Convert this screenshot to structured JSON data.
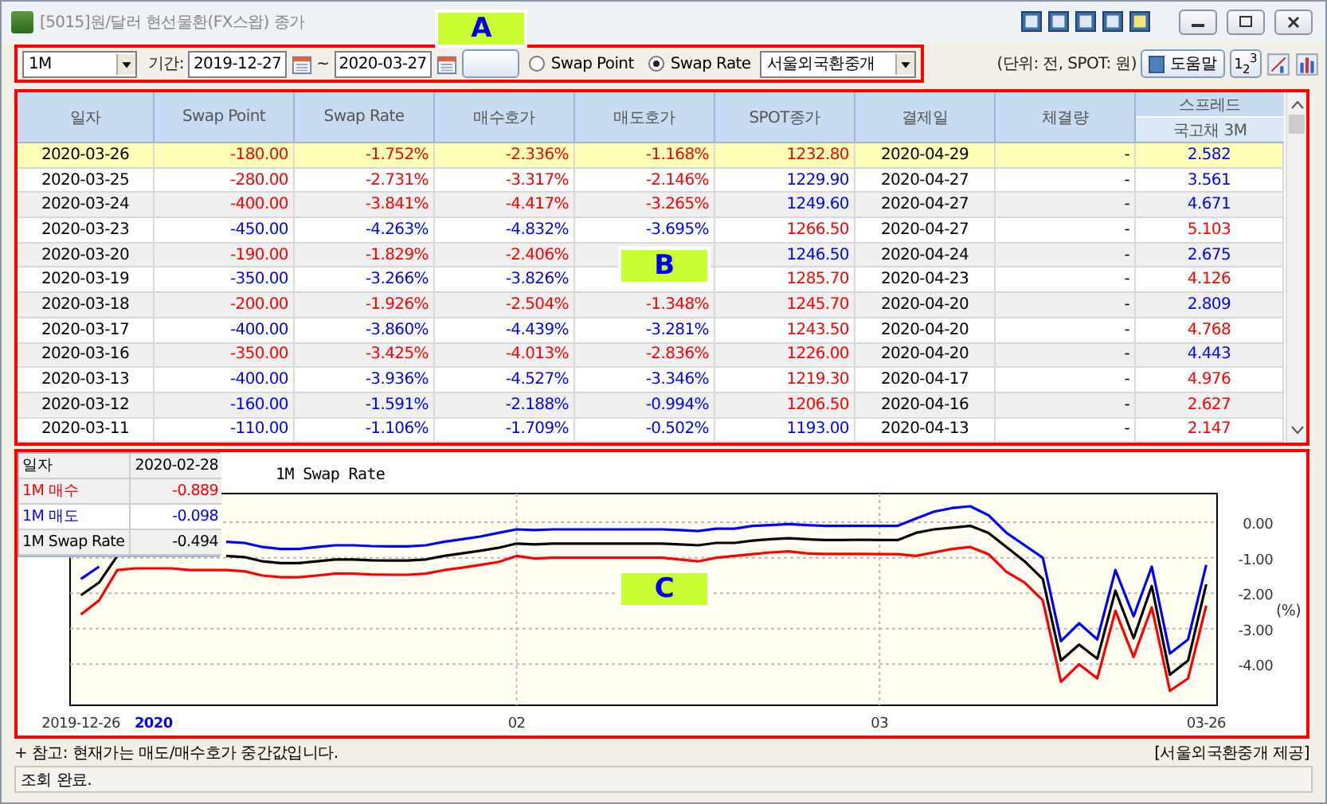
{
  "window": {
    "title": "[5015]원/달러 현선물환(FX스왑) 종가"
  },
  "toolbar": {
    "period_select": "1M",
    "period_label": "기간:",
    "start_date": "2019-12-27",
    "tilde": "~",
    "end_date": "2020-03-27",
    "radios": [
      {
        "label": "Swap Point",
        "selected": false
      },
      {
        "label": "Swap Rate",
        "selected": true
      }
    ],
    "broker_select": "서울외국환중개",
    "unit_note": "(단위: 전, SPOT: 원)",
    "help_button": "도움말",
    "number_format_button": "1$_{2}$$^{3}$"
  },
  "table": {
    "columns": [
      {
        "label": "일자"
      },
      {
        "label": "Swap Point"
      },
      {
        "label": "Swap Rate"
      },
      {
        "label": "매수호가"
      },
      {
        "label": "매도호가"
      },
      {
        "label": "SPOT종가"
      },
      {
        "label": "결제일"
      },
      {
        "label": "체결량"
      },
      {
        "label": "스프레드",
        "sublabel": "국고채 3M"
      }
    ],
    "rows": [
      {
        "selected": true,
        "cells": [
          "2020-03-26",
          {
            "text": "-180.00",
            "color": "#ff0000"
          },
          {
            "text": "-1.752%",
            "color": "#ff0000"
          },
          {
            "text": "-2.336%",
            "color": "#ff0000"
          },
          {
            "text": "-1.168%",
            "color": "#ff0000"
          },
          {
            "text": "1232.80",
            "color": "#ff0000"
          },
          "2020-04-29",
          "-",
          {
            "text": "2.582",
            "color": "#0000ff"
          }
        ]
      },
      {
        "selected": false,
        "cells": [
          "2020-03-25",
          {
            "text": "-280.00",
            "color": "#ff0000"
          },
          {
            "text": "-2.731%",
            "color": "#ff0000"
          },
          {
            "text": "-3.317%",
            "color": "#ff0000"
          },
          {
            "text": "-2.146%",
            "color": "#ff0000"
          },
          {
            "text": "1229.90",
            "color": "#0000ff"
          },
          "2020-04-27",
          "-",
          {
            "text": "3.561",
            "color": "#0000ff"
          }
        ]
      },
      {
        "selected": false,
        "cells": [
          "2020-03-24",
          {
            "text": "-400.00",
            "color": "#ff0000"
          },
          {
            "text": "-3.841%",
            "color": "#ff0000"
          },
          {
            "text": "-4.417%",
            "color": "#ff0000"
          },
          {
            "text": "-3.265%",
            "color": "#ff0000"
          },
          {
            "text": "1249.60",
            "color": "#0000ff"
          },
          "2020-04-27",
          "-",
          {
            "text": "4.671",
            "color": "#0000ff"
          }
        ]
      },
      {
        "selected": false,
        "cells": [
          "2020-03-23",
          {
            "text": "-450.00",
            "color": "#0000ff"
          },
          {
            "text": "-4.263%",
            "color": "#0000ff"
          },
          {
            "text": "-4.832%",
            "color": "#0000ff"
          },
          {
            "text": "-3.695%",
            "color": "#0000ff"
          },
          {
            "text": "1266.50",
            "color": "#ff0000"
          },
          "2020-04-27",
          "-",
          {
            "text": "5.103",
            "color": "#ff0000"
          }
        ]
      },
      {
        "selected": false,
        "cells": [
          "2020-03-20",
          {
            "text": "-190.00",
            "color": "#ff0000"
          },
          {
            "text": "-1.829%",
            "color": "#ff0000"
          },
          {
            "text": "-2.406%",
            "color": "#ff0000"
          },
          null,
          {
            "text": "1246.50",
            "color": "#0000ff"
          },
          "2020-04-24",
          "-",
          {
            "text": "2.675",
            "color": "#0000ff"
          }
        ]
      },
      {
        "selected": false,
        "cells": [
          "2020-03-19",
          {
            "text": "-350.00",
            "color": "#0000ff"
          },
          {
            "text": "-3.266%",
            "color": "#0000ff"
          },
          {
            "text": "-3.826%",
            "color": "#0000ff"
          },
          null,
          {
            "text": "1285.70",
            "color": "#ff0000"
          },
          "2020-04-23",
          "-",
          {
            "text": "4.126",
            "color": "#ff0000"
          }
        ]
      },
      {
        "selected": false,
        "cells": [
          "2020-03-18",
          {
            "text": "-200.00",
            "color": "#ff0000"
          },
          {
            "text": "-1.926%",
            "color": "#ff0000"
          },
          {
            "text": "-2.504%",
            "color": "#ff0000"
          },
          {
            "text": "-1.348%",
            "color": "#ff0000"
          },
          {
            "text": "1245.70",
            "color": "#ff0000"
          },
          "2020-04-20",
          "-",
          {
            "text": "2.809",
            "color": "#0000ff"
          }
        ]
      },
      {
        "selected": false,
        "cells": [
          "2020-03-17",
          {
            "text": "-400.00",
            "color": "#0000ff"
          },
          {
            "text": "-3.860%",
            "color": "#0000ff"
          },
          {
            "text": "-4.439%",
            "color": "#0000ff"
          },
          {
            "text": "-3.281%",
            "color": "#0000ff"
          },
          {
            "text": "1243.50",
            "color": "#ff0000"
          },
          "2020-04-20",
          "-",
          {
            "text": "4.768",
            "color": "#ff0000"
          }
        ]
      },
      {
        "selected": false,
        "cells": [
          "2020-03-16",
          {
            "text": "-350.00",
            "color": "#ff0000"
          },
          {
            "text": "-3.425%",
            "color": "#ff0000"
          },
          {
            "text": "-4.013%",
            "color": "#ff0000"
          },
          {
            "text": "-2.836%",
            "color": "#ff0000"
          },
          {
            "text": "1226.00",
            "color": "#ff0000"
          },
          "2020-04-20",
          "-",
          {
            "text": "4.443",
            "color": "#0000ff"
          }
        ]
      },
      {
        "selected": false,
        "cells": [
          "2020-03-13",
          {
            "text": "-400.00",
            "color": "#0000ff"
          },
          {
            "text": "-3.936%",
            "color": "#0000ff"
          },
          {
            "text": "-4.527%",
            "color": "#0000ff"
          },
          {
            "text": "-3.346%",
            "color": "#0000ff"
          },
          {
            "text": "1219.30",
            "color": "#ff0000"
          },
          "2020-04-17",
          "-",
          {
            "text": "4.976",
            "color": "#ff0000"
          }
        ]
      },
      {
        "selected": false,
        "cells": [
          "2020-03-12",
          {
            "text": "-160.00",
            "color": "#0000ff"
          },
          {
            "text": "-1.591%",
            "color": "#0000ff"
          },
          {
            "text": "-2.188%",
            "color": "#0000ff"
          },
          {
            "text": "-0.994%",
            "color": "#0000ff"
          },
          {
            "text": "1206.50",
            "color": "#ff0000"
          },
          "2020-04-16",
          "-",
          {
            "text": "2.627",
            "color": "#ff0000"
          }
        ]
      },
      {
        "selected": false,
        "cells": [
          "2020-03-11",
          {
            "text": "-110.00",
            "color": "#0000ff"
          },
          {
            "text": "-1.106%",
            "color": "#0000ff"
          },
          {
            "text": "-1.709%",
            "color": "#0000ff"
          },
          {
            "text": "-0.502%",
            "color": "#0000ff"
          },
          {
            "text": "1193.00",
            "color": "#0000ff"
          },
          "2020-04-13",
          "-",
          {
            "text": "2.147",
            "color": "#ff0000"
          }
        ]
      }
    ]
  },
  "chart": {
    "tooltip": {
      "date_label": "일자",
      "date": "2020-02-28",
      "values": [
        "-0.889",
        "-0.098",
        "-0.494"
      ]
    },
    "chart_data": {
      "type": "line",
      "title": "1M Swap Rate",
      "ylabel": "(%)",
      "grid": true,
      "categories": [
        "2019-12-26",
        null,
        null,
        null,
        "2020",
        null,
        null,
        null,
        null,
        null,
        null,
        null,
        null,
        null,
        null,
        null,
        null,
        null,
        null,
        null,
        null,
        null,
        null,
        null,
        "02",
        null,
        null,
        null,
        null,
        null,
        null,
        null,
        null,
        null,
        null,
        null,
        null,
        null,
        null,
        null,
        null,
        null,
        null,
        null,
        "03",
        null,
        null,
        null,
        null,
        null,
        null,
        null,
        null,
        null,
        null,
        null,
        null,
        null,
        null,
        null,
        null,
        null,
        "03-26"
      ],
      "ylim": [
        -5.16,
        0.81
      ],
      "yticks": [
        {
          "value": 0,
          "label": "0.00"
        },
        {
          "value": -1,
          "label": "-1.00"
        },
        {
          "value": -2,
          "label": "-2.00"
        },
        {
          "value": -3,
          "label": "-3.00"
        },
        {
          "value": -4,
          "label": "-4.00"
        }
      ],
      "series": [
        {
          "name": "1M 매수",
          "color": "#ff0000",
          "values": [
            -2.6,
            -2.2,
            -1.35,
            -1.3,
            -1.3,
            -1.3,
            -1.35,
            -1.35,
            -1.35,
            -1.38,
            -1.5,
            -1.55,
            -1.55,
            -1.5,
            -1.45,
            -1.45,
            -1.47,
            -1.48,
            -1.48,
            -1.45,
            -1.35,
            -1.28,
            -1.2,
            -1.12,
            -0.95,
            -1.02,
            -1.0,
            -1.0,
            -1.0,
            -1.0,
            -1.0,
            -1.0,
            -1.0,
            -1.05,
            -1.1,
            -1.0,
            -0.95,
            -0.9,
            -0.85,
            -0.82,
            -0.88,
            -0.89,
            -0.89,
            -0.89,
            -0.9,
            -0.9,
            -0.95,
            -0.85,
            -0.75,
            -0.7,
            -0.9,
            -1.4,
            -1.7,
            -2.2,
            -4.5,
            -4.0,
            -4.4,
            -2.5,
            -3.8,
            -2.4,
            -4.75,
            -4.4,
            -2.35
          ]
        },
        {
          "name": "1M 매도",
          "color": "#0000ff",
          "values": [
            -1.6,
            -1.25,
            null,
            null,
            null,
            null,
            null,
            null,
            -0.55,
            -0.58,
            -0.7,
            -0.75,
            -0.75,
            -0.7,
            -0.65,
            -0.65,
            -0.67,
            -0.68,
            -0.68,
            -0.65,
            -0.55,
            -0.48,
            -0.4,
            -0.3,
            -0.2,
            -0.22,
            -0.2,
            -0.2,
            -0.2,
            -0.2,
            -0.2,
            -0.2,
            -0.2,
            -0.22,
            -0.25,
            -0.18,
            -0.18,
            -0.1,
            -0.08,
            -0.05,
            -0.08,
            -0.1,
            -0.1,
            -0.1,
            -0.1,
            -0.1,
            0.1,
            0.3,
            0.4,
            0.45,
            0.2,
            -0.3,
            -0.65,
            -1.0,
            -3.35,
            -2.85,
            -3.3,
            -1.35,
            -2.65,
            -1.25,
            -3.7,
            -3.3,
            -1.2
          ]
        },
        {
          "name": "1M Swap Rate",
          "color": "#000000",
          "values": [
            -2.06,
            -1.7,
            -0.95,
            null,
            null,
            null,
            null,
            null,
            -0.95,
            -0.98,
            -1.1,
            -1.15,
            -1.15,
            -1.1,
            -1.05,
            -1.05,
            -1.07,
            -1.08,
            -1.08,
            -1.05,
            -0.95,
            -0.88,
            -0.8,
            -0.72,
            -0.6,
            -0.62,
            -0.6,
            -0.6,
            -0.6,
            -0.6,
            -0.6,
            -0.6,
            -0.6,
            -0.62,
            -0.65,
            -0.58,
            -0.58,
            -0.52,
            -0.48,
            -0.45,
            -0.48,
            -0.5,
            -0.5,
            -0.49,
            -0.5,
            -0.5,
            -0.3,
            -0.2,
            -0.15,
            -0.1,
            -0.3,
            -0.7,
            -1.1,
            -1.6,
            -3.9,
            -3.45,
            -3.85,
            -1.93,
            -3.27,
            -1.8,
            -4.3,
            -3.9,
            -1.75
          ]
        }
      ]
    }
  },
  "note": "+ 참고: 현재가는 매도/매수호가 중간값입니다.",
  "source": "[서울외국환중개 제공]",
  "status_bar": "조회 완료.",
  "callouts": [
    {
      "label": "A"
    },
    {
      "label": "B"
    },
    {
      "label": "C"
    }
  ]
}
